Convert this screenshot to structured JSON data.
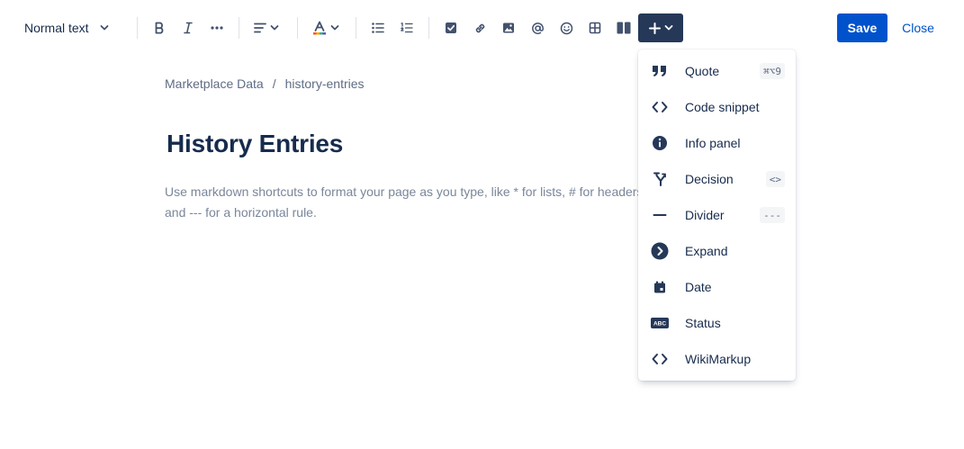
{
  "toolbar": {
    "text_style": "Normal text",
    "save_label": "Save",
    "close_label": "Close"
  },
  "breadcrumb": {
    "items": [
      "Marketplace Data",
      "history-entries"
    ],
    "separator": "/"
  },
  "page": {
    "title": "History Entries",
    "placeholder": "Use markdown shortcuts to format your page as you type, like * for lists, # for headers, and --- for a horizontal rule."
  },
  "insert_menu": {
    "items": [
      {
        "label": "Quote",
        "icon": "quote-icon",
        "shortcut": "⌘⌥9"
      },
      {
        "label": "Code snippet",
        "icon": "code-icon",
        "shortcut": ""
      },
      {
        "label": "Info panel",
        "icon": "info-icon",
        "shortcut": ""
      },
      {
        "label": "Decision",
        "icon": "decision-icon",
        "shortcut": "<>"
      },
      {
        "label": "Divider",
        "icon": "divider-icon",
        "shortcut": "---"
      },
      {
        "label": "Expand",
        "icon": "expand-icon",
        "shortcut": ""
      },
      {
        "label": "Date",
        "icon": "calendar-icon",
        "shortcut": ""
      },
      {
        "label": "Status",
        "icon": "status-icon",
        "shortcut": ""
      },
      {
        "label": "WikiMarkup",
        "icon": "code-icon",
        "shortcut": ""
      }
    ]
  },
  "colors": {
    "primary": "#0052cc",
    "insert_button": "#253858",
    "text_dark": "#172b4d",
    "text_subtle": "#5e6c84",
    "placeholder": "#7a869a"
  }
}
